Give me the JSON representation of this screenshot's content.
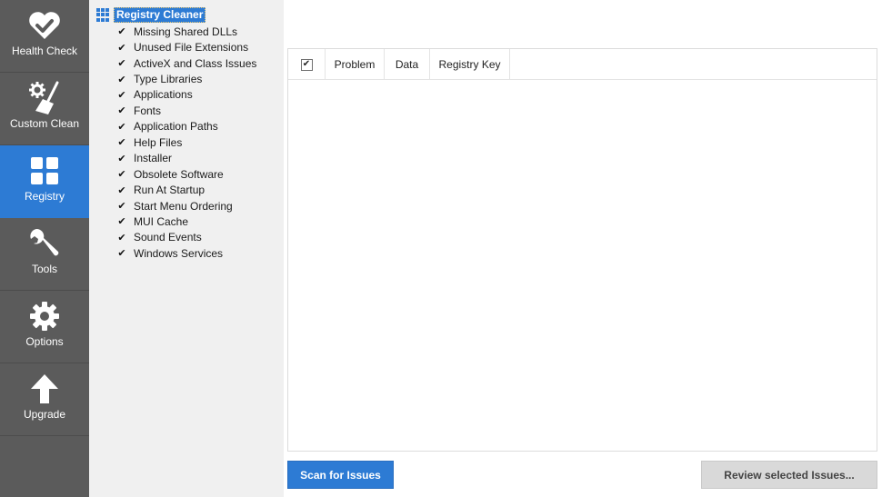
{
  "nav": {
    "items": [
      {
        "label": "Health Check",
        "icon": "heart-check-icon"
      },
      {
        "label": "Custom Clean",
        "icon": "broom-gear-icon"
      },
      {
        "label": "Registry",
        "icon": "grid-icon"
      },
      {
        "label": "Tools",
        "icon": "wrench-icon"
      },
      {
        "label": "Options",
        "icon": "gear-icon"
      },
      {
        "label": "Upgrade",
        "icon": "arrow-up-icon"
      }
    ],
    "active_index": 2,
    "colors": {
      "background": "#5b5b5b",
      "active": "#2d7bd4"
    }
  },
  "tree": {
    "root_label": "Registry Cleaner",
    "items": [
      {
        "label": "Missing Shared DLLs",
        "checked": true
      },
      {
        "label": "Unused File Extensions",
        "checked": true
      },
      {
        "label": "ActiveX and Class Issues",
        "checked": true
      },
      {
        "label": "Type Libraries",
        "checked": true
      },
      {
        "label": "Applications",
        "checked": true
      },
      {
        "label": "Fonts",
        "checked": true
      },
      {
        "label": "Application Paths",
        "checked": true
      },
      {
        "label": "Help Files",
        "checked": true
      },
      {
        "label": "Installer",
        "checked": true
      },
      {
        "label": "Obsolete Software",
        "checked": true
      },
      {
        "label": "Run At Startup",
        "checked": true
      },
      {
        "label": "Start Menu Ordering",
        "checked": true
      },
      {
        "label": "MUI Cache",
        "checked": true
      },
      {
        "label": "Sound Events",
        "checked": true
      },
      {
        "label": "Windows Services",
        "checked": true
      }
    ]
  },
  "results": {
    "select_all_checked": true,
    "columns": [
      "Problem",
      "Data",
      "Registry Key"
    ],
    "rows": []
  },
  "buttons": {
    "scan": "Scan for Issues",
    "review": "Review selected Issues..."
  },
  "check_glyph": "✔"
}
